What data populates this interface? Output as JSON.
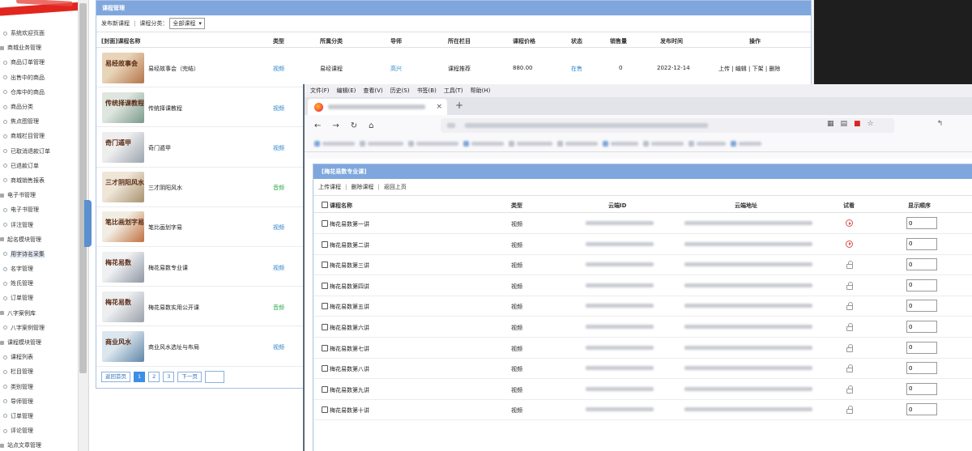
{
  "sidebar": {
    "items": [
      {
        "label": "系统欢迎页面",
        "kind": "child"
      },
      {
        "label": "商城业务管理",
        "kind": "group"
      },
      {
        "label": "商品订单管理",
        "kind": "child"
      },
      {
        "label": "出售中的商品",
        "kind": "child"
      },
      {
        "label": "仓库中的商品",
        "kind": "child"
      },
      {
        "label": "商品分类",
        "kind": "child"
      },
      {
        "label": "焦点图管理",
        "kind": "child"
      },
      {
        "label": "商城栏目管理",
        "kind": "child"
      },
      {
        "label": "已取消退款订单",
        "kind": "child"
      },
      {
        "label": "已退款订单",
        "kind": "child"
      },
      {
        "label": "商城销售报表",
        "kind": "child"
      },
      {
        "label": "电子书管理",
        "kind": "group"
      },
      {
        "label": "电子书管理",
        "kind": "child"
      },
      {
        "label": "评注管理",
        "kind": "child"
      },
      {
        "label": "起名模块管理",
        "kind": "group"
      },
      {
        "label": "用字诗名采集",
        "kind": "child"
      },
      {
        "label": "名字管理",
        "kind": "child"
      },
      {
        "label": "姓氏管理",
        "kind": "child"
      },
      {
        "label": "订单管理",
        "kind": "child"
      },
      {
        "label": "八字案例库",
        "kind": "group"
      },
      {
        "label": "八字案例管理",
        "kind": "child"
      },
      {
        "label": "课程模块管理",
        "kind": "group"
      },
      {
        "label": "课程列表",
        "kind": "child"
      },
      {
        "label": "栏目管理",
        "kind": "child"
      },
      {
        "label": "类别管理",
        "kind": "child"
      },
      {
        "label": "导师管理",
        "kind": "child"
      },
      {
        "label": "订单管理",
        "kind": "child"
      },
      {
        "label": "评论管理",
        "kind": "child"
      },
      {
        "label": "站点文章管理",
        "kind": "group"
      }
    ]
  },
  "course_manager": {
    "title": "课程管理",
    "toolbar": {
      "publish": "发布新课程",
      "category_label": "课程分类：",
      "category_value": "全部课程",
      "sep": "|"
    },
    "columns": [
      "[封面]课程名称",
      "类型",
      "所属分类",
      "导师",
      "所在栏目",
      "课程价格",
      "状态",
      "销售量",
      "发布时间",
      "操作"
    ],
    "rows": [
      {
        "name": "易经故事会（完结）",
        "type": "视频",
        "type_kind": "video",
        "category": "易经课程",
        "teacher": "高兴",
        "column": "课程推荐",
        "price": "880.00",
        "status": "在售",
        "sales": "0",
        "date": "2022-12-14",
        "ops": "上传 | 编辑 | 下架 | 删除",
        "thumb_title": "易经故事会",
        "thumb_colors": [
          "#e8d4b8",
          "#b4744a"
        ]
      },
      {
        "name": "传统择课教程",
        "type": "视频",
        "type_kind": "video",
        "thumb_title": "传统择课教程",
        "thumb_colors": [
          "#dfe6df",
          "#7a9a8a"
        ]
      },
      {
        "name": "奇门遁甲",
        "type": "视频",
        "type_kind": "video",
        "thumb_title": "奇门遁甲",
        "thumb_colors": [
          "#eeeeee",
          "#9aa4ae"
        ]
      },
      {
        "name": "三才阴阳风水",
        "type": "音频",
        "type_kind": "audio",
        "thumb_title": "三才阴阳风水",
        "thumb_colors": [
          "#efe6d8",
          "#a8926f"
        ]
      },
      {
        "name": "笔比画划字易",
        "type": "视频",
        "type_kind": "video",
        "thumb_title": "笔比画划字易",
        "thumb_colors": [
          "#f2ede2",
          "#c0703e"
        ]
      },
      {
        "name": "梅花易数专业课",
        "type": "视频",
        "type_kind": "video",
        "thumb_title": "梅花易数",
        "thumb_colors": [
          "#eef0f2",
          "#8e96a2"
        ]
      },
      {
        "name": "梅花易数实用公开课",
        "type": "音频",
        "type_kind": "audio",
        "thumb_title": "梅花易数",
        "thumb_colors": [
          "#eceef0",
          "#9aa0a8"
        ]
      },
      {
        "name": "商业风水选址与布局",
        "type": "视频",
        "type_kind": "video",
        "thumb_title": "商业风水",
        "thumb_colors": [
          "#dbe6ee",
          "#5f86a6"
        ]
      }
    ],
    "pager": {
      "home": "返回首页",
      "pages": [
        "1",
        "2",
        "3"
      ],
      "current": "1",
      "next": "下一页"
    }
  },
  "browser": {
    "menu": [
      "文件(F)",
      "编辑(E)",
      "查看(V)",
      "历史(S)",
      "书签(B)",
      "工具(T)",
      "帮助(H)"
    ],
    "tab_close": "×",
    "new_tab": "+",
    "nav": {
      "back": "←",
      "forward": "→",
      "reload": "↻",
      "home": "⌂"
    },
    "page": {
      "title": "[梅花易数专业课]",
      "toolbar": [
        "上传课程",
        "删除课程",
        "返回上页"
      ],
      "columns": [
        "课程名称",
        "类型",
        "云端ID",
        "云端地址",
        "试看",
        "显示顺序"
      ],
      "rows": [
        {
          "name": "梅花易数第一讲",
          "type": "视频",
          "trial": "play",
          "order": "0"
        },
        {
          "name": "梅花易数第二讲",
          "type": "视频",
          "trial": "play",
          "order": "0"
        },
        {
          "name": "梅花易数第三讲",
          "type": "视频",
          "trial": "lock",
          "order": "0"
        },
        {
          "name": "梅花易数第四讲",
          "type": "视频",
          "trial": "lock",
          "order": "0"
        },
        {
          "name": "梅花易数第五讲",
          "type": "视频",
          "trial": "lock",
          "order": "0"
        },
        {
          "name": "梅花易数第六讲",
          "type": "视频",
          "trial": "lock",
          "order": "0"
        },
        {
          "name": "梅花易数第七讲",
          "type": "视频",
          "trial": "lock",
          "order": "0"
        },
        {
          "name": "梅花易数第八讲",
          "type": "视频",
          "trial": "lock",
          "order": "0"
        },
        {
          "name": "梅花易数第九讲",
          "type": "视频",
          "trial": "lock",
          "order": "0"
        },
        {
          "name": "梅花易数第十讲",
          "type": "视频",
          "trial": "lock",
          "order": "0"
        }
      ]
    }
  }
}
